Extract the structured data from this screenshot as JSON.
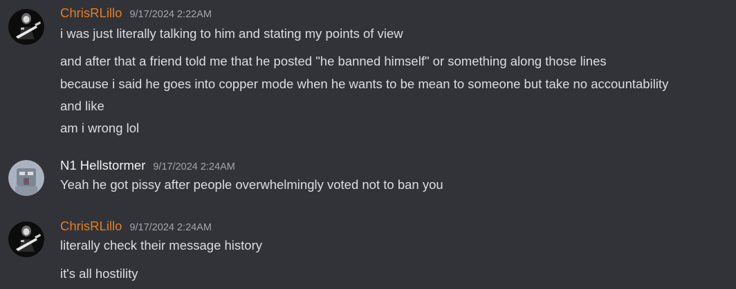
{
  "colors": {
    "background": "#313338",
    "text": "#dbdee1",
    "timestamp": "#a3a6aa",
    "chris_name": "#e67e22",
    "n1_name": "#f2f3f5"
  },
  "messages": [
    {
      "author": "ChrisRLillo",
      "timestamp": "9/17/2024 2:22AM",
      "avatar_icon": "guitarist-avatar-icon",
      "lines": [
        "i was just literally talking to him and stating my points of view",
        "and after that a friend told me that he posted \"he banned himself\" or something along those lines",
        "because i said he goes into copper mode when he wants to be mean to someone but take no accountability",
        "and like",
        "am i wrong lol"
      ]
    },
    {
      "author": "N1 Hellstormer",
      "timestamp": "9/17/2024 2:24AM",
      "avatar_icon": "robot-avatar-icon",
      "lines": [
        "Yeah he got pissy after people overwhelmingly voted not to ban you"
      ]
    },
    {
      "author": "ChrisRLillo",
      "timestamp": "9/17/2024 2:24AM",
      "avatar_icon": "guitarist-avatar-icon",
      "lines": [
        "literally check their message history",
        "it's all hostility"
      ]
    }
  ]
}
